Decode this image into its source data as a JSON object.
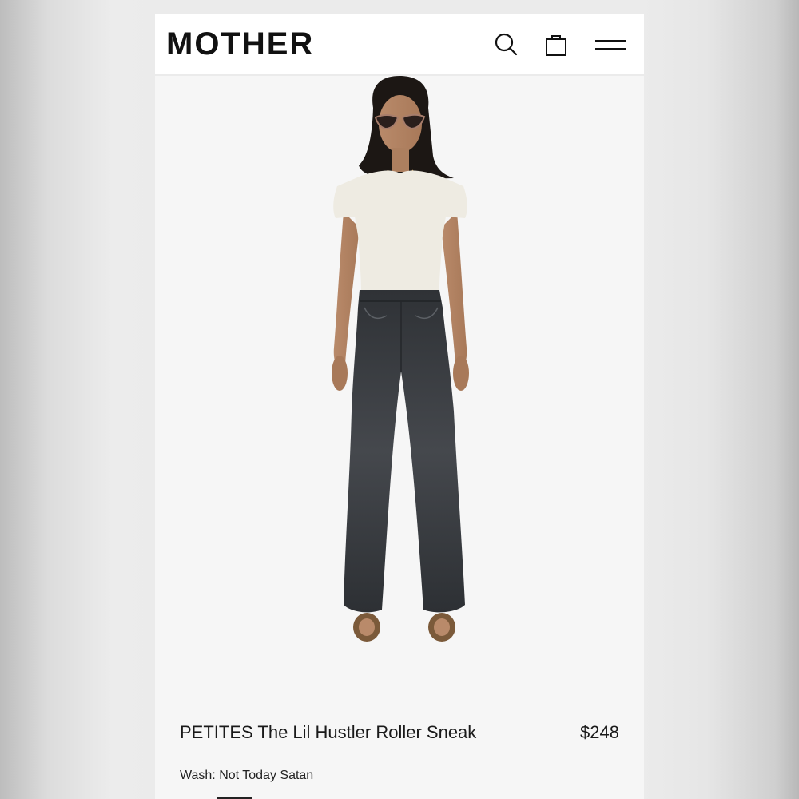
{
  "header": {
    "brand": "MOTHER",
    "icons": [
      "search-icon",
      "shopping-bag-icon",
      "hamburger-menu-icon"
    ]
  },
  "product": {
    "name": "PETITES The Lil Hustler Roller Sneak",
    "price": "$248",
    "wash_line": "Wash: Not Today Satan"
  },
  "colors": {
    "page_background": "#f6f6f6",
    "header_background": "#ffffff",
    "text": "#1a1a1a",
    "denim": "#3a3d42",
    "tee": "#eeebe2"
  }
}
